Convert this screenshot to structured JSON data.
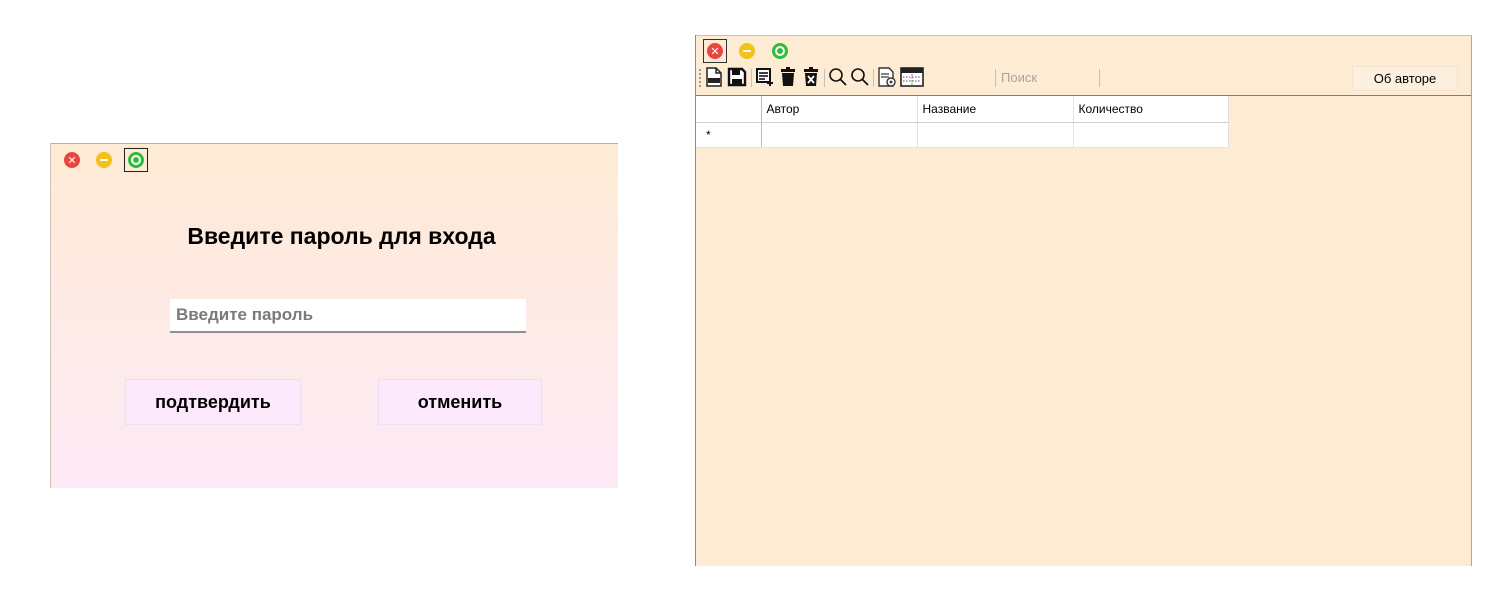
{
  "login_window": {
    "title": "Введите пароль для входа",
    "password_placeholder": "Введите пароль",
    "password_value": "",
    "confirm_label": "подтвердить",
    "cancel_label": "отменить",
    "close_glyph": "✕"
  },
  "main_window": {
    "close_glyph": "✕",
    "toolbar": {
      "icons": [
        "new-file-icon",
        "save-icon",
        "add-row-icon",
        "delete-icon",
        "clear-icon",
        "search-icon",
        "search-alt-icon",
        "report-icon",
        "layout-icon"
      ],
      "search_label": "Поиск",
      "about_label": "Об авторе"
    },
    "grid": {
      "columns": [
        "Автор",
        "Название",
        "Количество"
      ],
      "new_row_marker": "*",
      "rows": []
    }
  },
  "colors": {
    "window_bg": "#feebd4",
    "login_gradient_bottom": "#fde9f6",
    "button_pink": "#fde9fc",
    "close_red": "#e8463f",
    "minimize_yellow": "#f3c01c",
    "maximize_green": "#2fbd3a"
  }
}
